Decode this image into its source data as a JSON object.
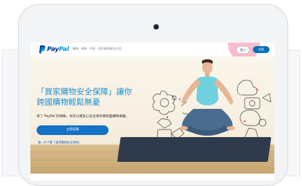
{
  "header": {
    "logo_pay": "Pay",
    "logo_pal": "Pal",
    "nav_text": "購物 · 銷售 · 付款 · 商家貿易解決方案",
    "login_label": "登入",
    "signup_label": "註冊"
  },
  "hero": {
    "headline": "「買家購物安全保障」讓你\n跨國購物輕鬆無憂",
    "subtext": "有了 PayPal 的保障，你可以更安心在台灣享受跨國購物樂趣。",
    "cta_label": "立即註冊",
    "learn_more": "進一步了解「買家購物安全保障」"
  },
  "colors": {
    "brand_dark": "#003087",
    "brand_light": "#009cde",
    "headline": "#1c8fcf",
    "cta": "#1471c4",
    "highlight": "#f4a7bb"
  }
}
